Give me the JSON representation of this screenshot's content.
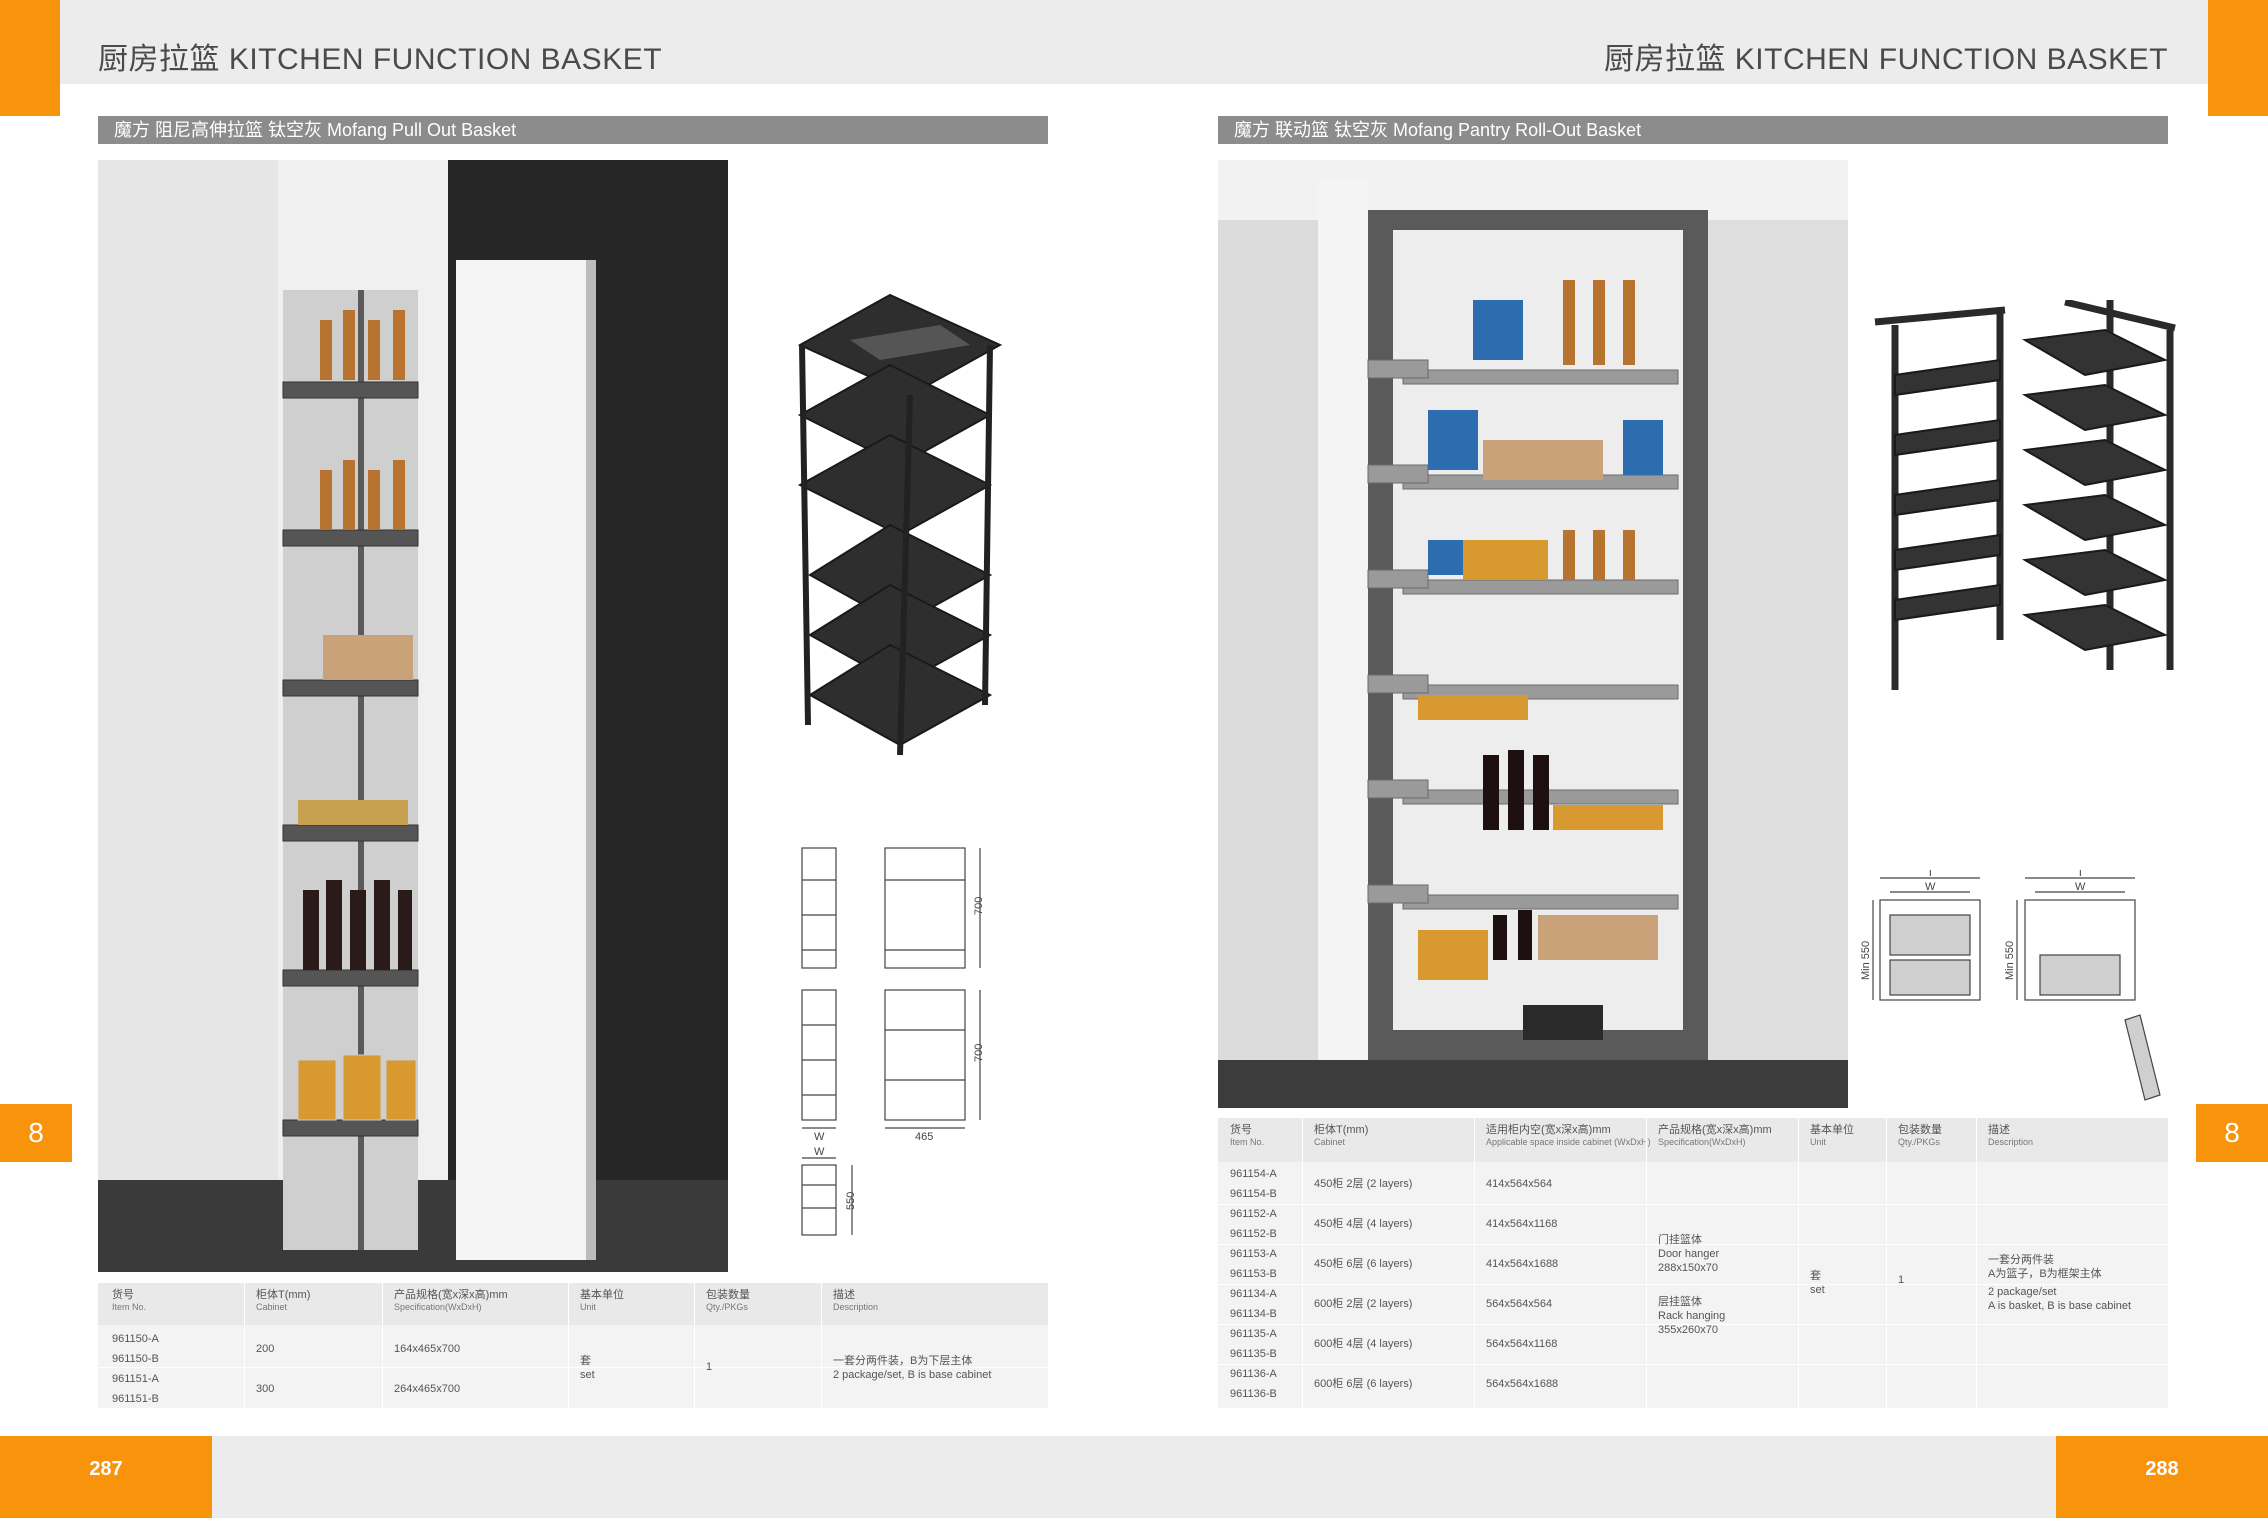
{
  "header": {
    "left_title": "厨房拉篮  KITCHEN FUNCTION BASKET",
    "right_title": "厨房拉篮  KITCHEN FUNCTION BASKET"
  },
  "left_section": {
    "title": "魔方  阻尼高伸拉篮  钛空灰     Mofang Pull Out Basket",
    "side_tab": "8",
    "page_number": "287",
    "dims": {
      "h1": "700",
      "h2": "700",
      "w": "W",
      "d": "465",
      "w2": "W",
      "h3": "550"
    },
    "table": {
      "headers": [
        {
          "cn": "货号",
          "en": "Item No."
        },
        {
          "cn": "柜体T(mm)",
          "en": "Cabinet"
        },
        {
          "cn": "产品规格(宽x深x高)mm",
          "en": "Specification(WxDxH)"
        },
        {
          "cn": "基本单位",
          "en": "Unit"
        },
        {
          "cn": "包装数量",
          "en": "Qty./PKGs"
        },
        {
          "cn": "描述",
          "en": "Description"
        }
      ],
      "items": [
        "961150-A",
        "961150-B",
        "961151-A",
        "961151-B"
      ],
      "cabinets": [
        "200",
        "300"
      ],
      "specs": [
        "164x465x700",
        "264x465x700"
      ],
      "unit_cn": "套",
      "unit_en": "set",
      "qty": "1",
      "desc_cn": "一套分两件装，B为下层主体",
      "desc_en": "2 package/set, B is base cabinet"
    }
  },
  "right_section": {
    "title": "魔方  联动篮  钛空灰     Mofang Pantry Roll-Out Basket",
    "side_tab": "8",
    "page_number": "288",
    "dims": {
      "t1": "T",
      "w1": "W",
      "min1": "Min 550",
      "t2": "T",
      "w2": "W",
      "min2": "Min 550"
    },
    "table": {
      "headers": [
        {
          "cn": "货号",
          "en": "Item No."
        },
        {
          "cn": "柜体T(mm)",
          "en": "Cabinet"
        },
        {
          "cn": "适用柜内空(宽x深x高)mm",
          "en": "Applicable space inside cabinet (WxDxH)"
        },
        {
          "cn": "产品规格(宽x深x高)mm",
          "en": "Specification(WxDxH)"
        },
        {
          "cn": "基本单位",
          "en": "Unit"
        },
        {
          "cn": "包装数量",
          "en": "Qty./PKGs"
        },
        {
          "cn": "描述",
          "en": "Description"
        }
      ],
      "items": [
        "961154-A",
        "961154-B",
        "961152-A",
        "961152-B",
        "961153-A",
        "961153-B",
        "961134-A",
        "961134-B",
        "961135-A",
        "961135-B",
        "961136-A",
        "961136-B"
      ],
      "cabinets": [
        "450柜  2层  (2 layers)",
        "450柜  4层  (4 layers)",
        "450柜  6层  (6 layers)",
        "600柜  2层  (2 layers)",
        "600柜  4层  (4 layers)",
        "600柜  6层  (6 layers)"
      ],
      "spaces": [
        "414x564x564",
        "414x564x1168",
        "414x564x1688",
        "564x564x564",
        "564x564x1168",
        "564x564x1688"
      ],
      "spec_lines": [
        "门挂篮体",
        "Door hanger",
        "288x150x70",
        "层挂篮体",
        "Rack hanging",
        "355x260x70"
      ],
      "unit_cn": "套",
      "unit_en": "set",
      "qty": "1",
      "desc_lines": [
        "一套分两件装",
        "A为篮子，B为框架主体",
        "2 package/set",
        "A is basket, B is base cabinet"
      ]
    }
  }
}
